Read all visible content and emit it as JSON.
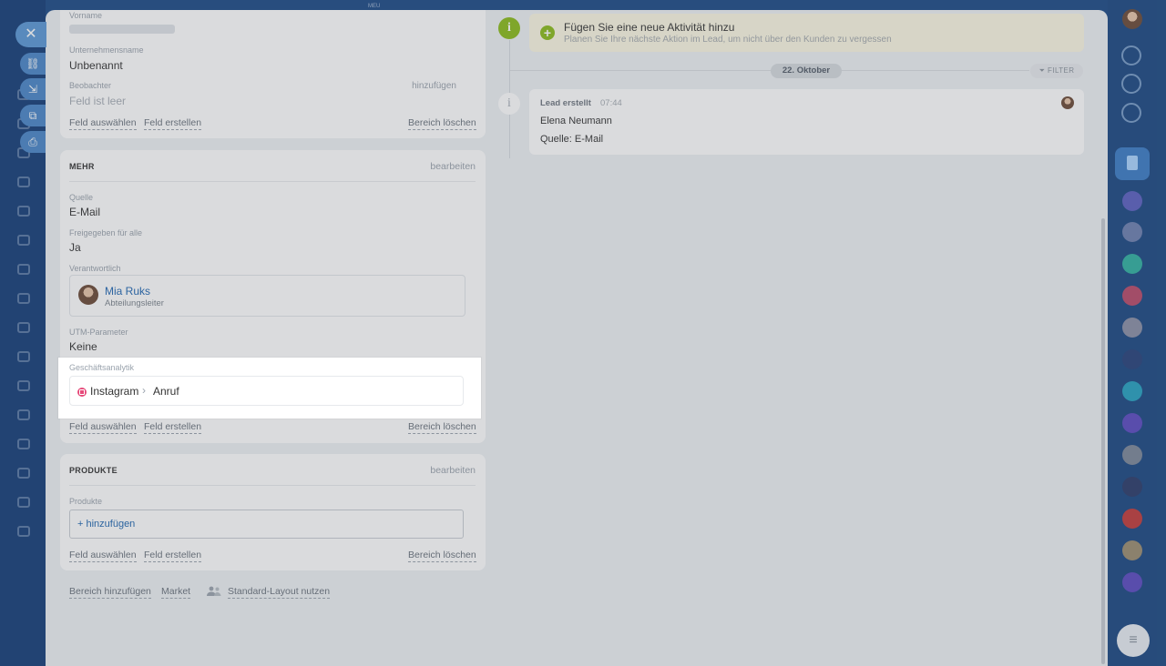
{
  "left_card_1": {
    "firstname_label": "Vorname",
    "company_label": "Unternehmensname",
    "company_value": "Unbenannt",
    "observer_label": "Beobachter",
    "observer_add": "hinzufügen",
    "observer_value": "Feld ist leer",
    "select_field": "Feld auswählen",
    "create_field": "Feld erstellen",
    "delete_section": "Bereich löschen"
  },
  "more_card": {
    "title": "MEHR",
    "edit": "bearbeiten",
    "source_label": "Quelle",
    "source_value": "E-Mail",
    "shared_label": "Freigegeben für alle",
    "shared_value": "Ja",
    "responsible_label": "Verantwortlich",
    "responsible_name": "Mia Ruks",
    "responsible_role": "Abteilungsleiter",
    "utm_label": "UTM-Parameter",
    "utm_value": "Keine",
    "select_field": "Feld auswählen",
    "create_field": "Feld erstellen",
    "delete_section": "Bereich löschen"
  },
  "analytics": {
    "label": "Geschäftsanalytik",
    "source": "Instagram",
    "separator": "›",
    "channel": "Anruf"
  },
  "products_card": {
    "title": "PRODUKTE",
    "edit": "bearbeiten",
    "products_label": "Produkte",
    "add": "+ hinzufügen",
    "select_field": "Feld auswählen",
    "create_field": "Feld erstellen",
    "delete_section": "Bereich löschen"
  },
  "bottom_links": {
    "add_section": "Bereich hinzufügen",
    "market": "Market",
    "standard_layout": "Standard-Layout nutzen"
  },
  "timeline": {
    "activity_title": "Fügen Sie eine neue Aktivität hinzu",
    "activity_sub": "Planen Sie Ihre nächste Aktion im Lead, um nicht über den Kunden zu vergessen",
    "date": "22. Oktober",
    "filter": "FILTER",
    "lead_title": "Lead erstellt",
    "lead_time": "07:44",
    "lead_name": "Elena Neumann",
    "lead_source": "Quelle: E-Mail"
  },
  "window": {
    "top_label": "MEU",
    "close_glyph": "✕",
    "menu_glyph": "≡"
  },
  "colors": {
    "accent": "#2067b0",
    "timeline_green": "#8bbb1a",
    "instagram": "#e64a7a",
    "backdrop": "#1c4a86"
  }
}
